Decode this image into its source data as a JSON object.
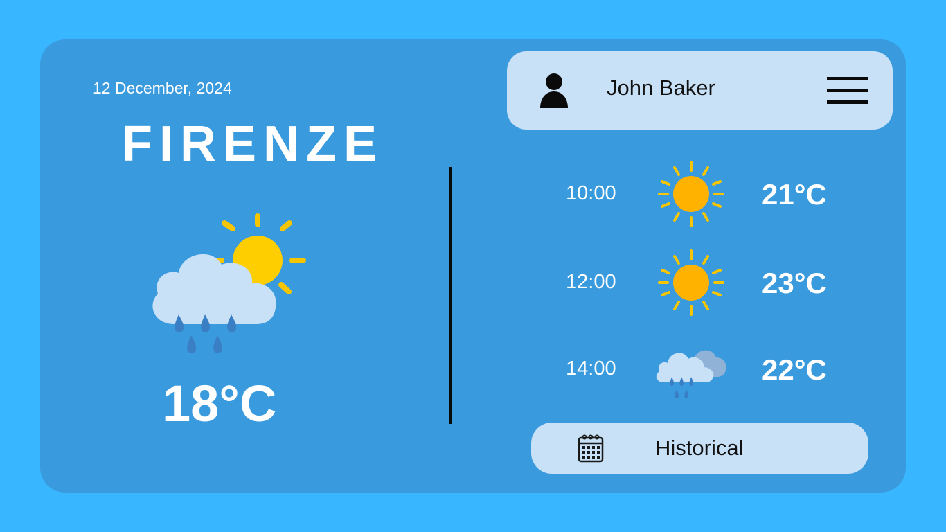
{
  "date": "12 December, 2024",
  "city": "FIRENZE",
  "current": {
    "temperature": "18°C",
    "icon": "sun-behind-rain-cloud-icon"
  },
  "user": {
    "name": "John Baker",
    "icon": "user-icon",
    "menu_icon": "hamburger-menu-icon"
  },
  "forecast": [
    {
      "time": "10:00",
      "icon": "sun-icon",
      "temp": "21°C"
    },
    {
      "time": "12:00",
      "icon": "sun-icon",
      "temp": "23°C"
    },
    {
      "time": "14:00",
      "icon": "rain-cloud-icon",
      "temp": "22°C"
    }
  ],
  "historical": {
    "label": "Historical",
    "icon": "calendar-icon"
  },
  "colors": {
    "background": "#38b6ff",
    "card": "#3a9ade",
    "pill": "#c8e1f7",
    "sun": "#ffb300",
    "sun_rays": "#f7c600"
  }
}
